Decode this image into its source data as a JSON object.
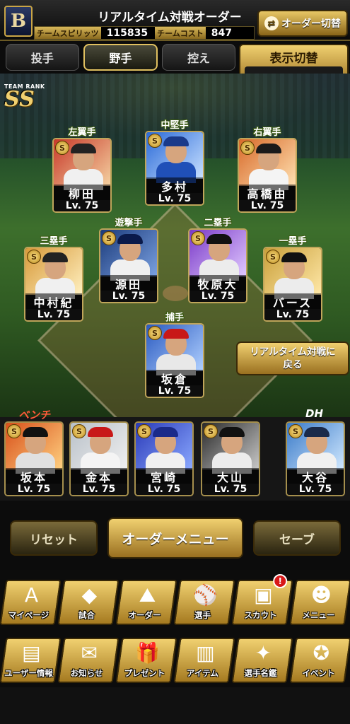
{
  "header": {
    "team_logo": "B",
    "title": "リアルタイム対戦オーダー",
    "team_spirit_label": "チームスピリッツ",
    "team_spirit_value": "115835",
    "team_cost_label": "チームコスト",
    "team_cost_value": "847",
    "order_switch_label": "オーダー切替",
    "order_switch_icon": "swap-icon"
  },
  "tabs": [
    {
      "label": "投手",
      "active": false
    },
    {
      "label": "野手",
      "active": true
    },
    {
      "label": "控え",
      "active": false
    }
  ],
  "display_toggle": {
    "label": "表示切替",
    "value": "–"
  },
  "team_rank": {
    "label": "TEAM RANK",
    "value": "SS"
  },
  "lineup": [
    {
      "position": "左翼手",
      "name": "柳田",
      "level": "Lv. 75",
      "badge": "S",
      "colors": [
        "#c83a2a",
        "#f4d0a0"
      ],
      "cap": "#222",
      "uni": "#f0f0f0"
    },
    {
      "position": "中堅手",
      "name": "多村",
      "level": "Lv. 75",
      "badge": "S",
      "colors": [
        "#2a6ad8",
        "#c8e0ff"
      ],
      "cap": "#1a3a8a",
      "uni": "#2050b8"
    },
    {
      "position": "右翼手",
      "name": "高橋由",
      "level": "Lv. 75",
      "badge": "S",
      "colors": [
        "#d86a2a",
        "#ffe0b0"
      ],
      "cap": "#1a1a1a",
      "uni": "#f4f4f4"
    },
    {
      "position": "三塁手",
      "name": "中村紀",
      "level": "Lv. 75",
      "badge": "S",
      "colors": [
        "#d89a3a",
        "#fff0c0"
      ],
      "cap": "#222",
      "uni": "#f0f0f0"
    },
    {
      "position": "遊撃手",
      "name": "源田",
      "level": "Lv. 75",
      "badge": "S",
      "colors": [
        "#1a3a7a",
        "#7aa0e0"
      ],
      "cap": "#0a1a4a",
      "uni": "#f0f0f0"
    },
    {
      "position": "二塁手",
      "name": "牧原大",
      "level": "Lv. 75",
      "badge": "S",
      "colors": [
        "#7a3ac8",
        "#e0c8ff"
      ],
      "cap": "#111",
      "uni": "#ececec"
    },
    {
      "position": "一塁手",
      "name": "バース",
      "level": "Lv. 75",
      "badge": "S",
      "colors": [
        "#caa03a",
        "#ffe8a8"
      ],
      "cap": "#111",
      "uni": "#ececec"
    },
    {
      "position": "捕手",
      "name": "坂倉",
      "level": "Lv. 75",
      "badge": "S",
      "colors": [
        "#2a5ac0",
        "#b0d0ff"
      ],
      "cap": "#c81818",
      "uni": "#e8e8e8"
    }
  ],
  "back_button": {
    "line1": "リアルタイム対戦に",
    "line2": "戻る"
  },
  "bench_label": "ベンチ",
  "dh_label": "DH",
  "bench": [
    {
      "name": "坂本",
      "level": "Lv. 75",
      "badge": "S",
      "colors": [
        "#d8501a",
        "#ffd080"
      ],
      "cap": "#111",
      "uni": "#e0e0e0"
    },
    {
      "name": "金本",
      "level": "Lv. 75",
      "badge": "S",
      "colors": [
        "#b8c0c8",
        "#f0f0f0"
      ],
      "cap": "#c81818",
      "uni": "#f4f4f4"
    },
    {
      "name": "宮崎",
      "level": "Lv. 75",
      "badge": "S",
      "colors": [
        "#2a3ab8",
        "#8aa8ff"
      ],
      "cap": "#1a2a8a",
      "uni": "#f0f0f0"
    },
    {
      "name": "大山",
      "level": "Lv. 75",
      "badge": "S",
      "colors": [
        "#2a2a2a",
        "#c8c8c8"
      ],
      "cap": "#111",
      "uni": "#ececec"
    },
    {
      "name": "大谷",
      "level": "Lv. 75",
      "badge": "S",
      "colors": [
        "#3a7ac8",
        "#d0e8ff"
      ],
      "cap": "#1a2a4a",
      "uni": "#f0f0f0"
    }
  ],
  "order_buttons": {
    "reset": "リセット",
    "menu": "オーダーメニュー",
    "save": "セーブ"
  },
  "menu_row1": [
    {
      "label": "マイページ",
      "icon": "letter-a-icon",
      "glyph": "A"
    },
    {
      "label": "試合",
      "icon": "baseball-field-icon",
      "glyph": "◆"
    },
    {
      "label": "オーダー",
      "icon": "field-lineup-icon",
      "glyph": "⛰"
    },
    {
      "label": "選手",
      "icon": "player-icon",
      "glyph": "⚾"
    },
    {
      "label": "スカウト",
      "icon": "scout-card-icon",
      "glyph": "▣",
      "notification": "!"
    },
    {
      "label": "メニュー",
      "icon": "menu-character-icon",
      "glyph": "☻"
    }
  ],
  "menu_row2": [
    {
      "label": "ユーザー情報",
      "icon": "user-card-icon",
      "glyph": "▤"
    },
    {
      "label": "お知らせ",
      "icon": "notice-box-icon",
      "glyph": "✉"
    },
    {
      "label": "プレゼント",
      "icon": "gift-icon",
      "glyph": "🎁"
    },
    {
      "label": "アイテム",
      "icon": "item-cards-icon",
      "glyph": "▥"
    },
    {
      "label": "選手名鑑",
      "icon": "player-book-icon",
      "glyph": "✦"
    },
    {
      "label": "イベント",
      "icon": "event-glove-icon",
      "glyph": "✪"
    }
  ]
}
